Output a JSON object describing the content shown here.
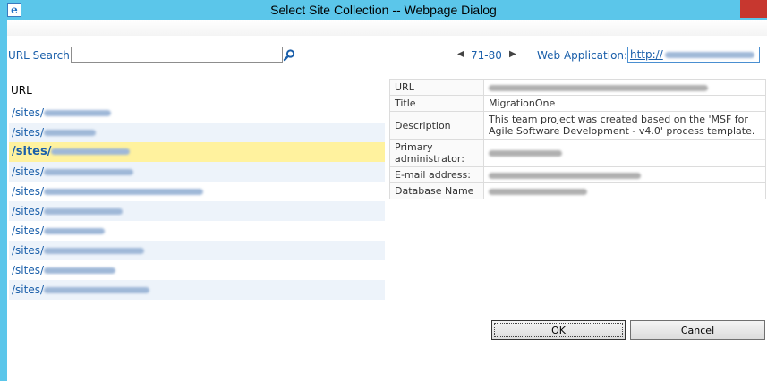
{
  "window": {
    "title": "Select Site Collection -- Webpage Dialog",
    "app_icon": "ie-icon",
    "close_icon": "close-icon"
  },
  "search": {
    "label": "URL Search",
    "value": ""
  },
  "pager": {
    "range": "71-80",
    "prev_icon": "caret-left-icon",
    "next_icon": "caret-right-icon"
  },
  "web_application": {
    "label": "Web Application:",
    "value": "http://"
  },
  "site_list": {
    "header": "URL",
    "items": [
      {
        "prefix": "/sites/"
      },
      {
        "prefix": "/sites/"
      },
      {
        "prefix": "/sites/",
        "selected": true
      },
      {
        "prefix": "/sites/"
      },
      {
        "prefix": "/sites/"
      },
      {
        "prefix": "/sites/"
      },
      {
        "prefix": "/sites/"
      },
      {
        "prefix": "/sites/"
      },
      {
        "prefix": "/sites/"
      },
      {
        "prefix": "/sites/"
      }
    ]
  },
  "details": {
    "url_label": "URL",
    "title_label": "Title",
    "title_value": "MigrationOne",
    "description_label": "Description",
    "description_value": "This team project was created based on the 'MSF for Agile Software Development - v4.0' process template.",
    "primary_admin_label": "Primary administrator:",
    "email_label": "E-mail address:",
    "database_label": "Database Name"
  },
  "buttons": {
    "ok": "OK",
    "cancel": "Cancel"
  },
  "colors": {
    "title_bar": "#5bc6ea",
    "link": "#1a5faa",
    "selected_row": "#fff29e",
    "alt_row": "#edf3fa",
    "close_button": "#c7372f"
  }
}
